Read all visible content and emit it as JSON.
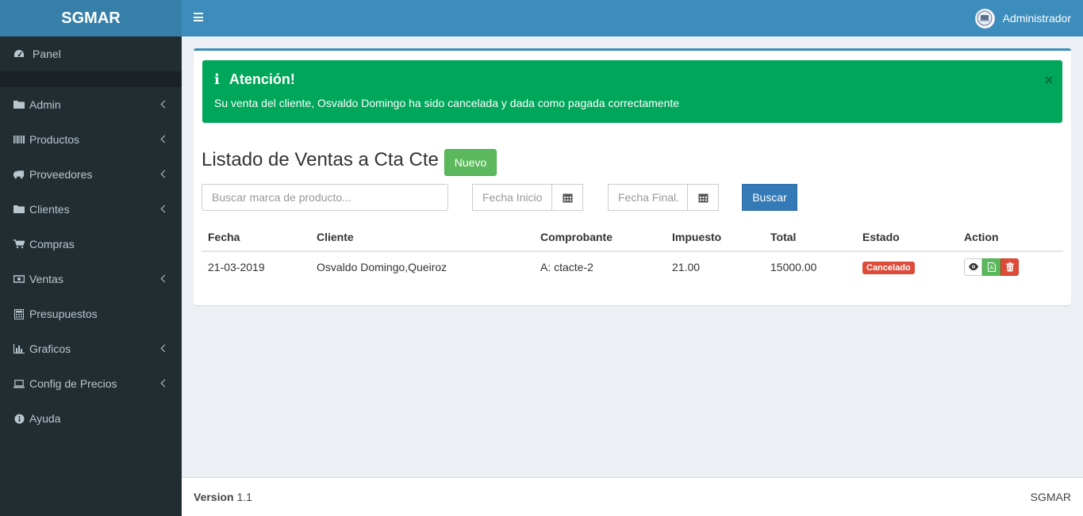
{
  "app": {
    "logo": "SGMAR"
  },
  "header": {
    "user_name": "Administrador"
  },
  "sidebar": {
    "items": [
      {
        "label": "Panel",
        "icon": "dashboard-icon",
        "submenu": false
      },
      {
        "label": "Admin",
        "icon": "folder-icon",
        "submenu": true
      },
      {
        "label": "Productos",
        "icon": "barcode-icon",
        "submenu": true
      },
      {
        "label": "Proveedores",
        "icon": "truck-icon",
        "submenu": true
      },
      {
        "label": "Clientes",
        "icon": "folder-icon",
        "submenu": true
      },
      {
        "label": "Compras",
        "icon": "cart-icon",
        "submenu": false
      },
      {
        "label": "Ventas",
        "icon": "money-icon",
        "submenu": true
      },
      {
        "label": "Presupuestos",
        "icon": "calculator-icon",
        "submenu": false
      },
      {
        "label": "Graficos",
        "icon": "bar-chart-icon",
        "submenu": true
      },
      {
        "label": "Config de Precios",
        "icon": "laptop-icon",
        "submenu": true
      },
      {
        "label": "Ayuda",
        "icon": "info-circle-icon",
        "submenu": false
      }
    ]
  },
  "alert": {
    "title": "Atención!",
    "message": "Su venta del cliente, Osvaldo Domingo ha sido cancelada y dada como pagada correctamente",
    "close": "×",
    "color": "#00a65a"
  },
  "page": {
    "title": "Listado de Ventas a Cta Cte",
    "new_button": "Nuevo"
  },
  "filters": {
    "search_placeholder": "Buscar marca de producto...",
    "start_placeholder": "Fecha Inicio",
    "end_placeholder": "Fecha Final.",
    "search_button": "Buscar"
  },
  "table": {
    "headers": [
      "Fecha",
      "Cliente",
      "Comprobante",
      "Impuesto",
      "Total",
      "Estado",
      "Action"
    ],
    "rows": [
      {
        "fecha": "21-03-2019",
        "cliente": "Osvaldo Domingo,Queiroz",
        "comprobante": "A: ctacte-2",
        "impuesto": "21.00",
        "total": "15000.00",
        "estado": "Cancelado"
      }
    ]
  },
  "footer": {
    "version_label": "Version",
    "version": "1.1",
    "brand": "SGMAR"
  },
  "colors": {
    "header": "#3c8dbc",
    "sidebar": "#222d32",
    "success": "#00a65a",
    "danger": "#dd4b39",
    "primary": "#337ab7"
  }
}
